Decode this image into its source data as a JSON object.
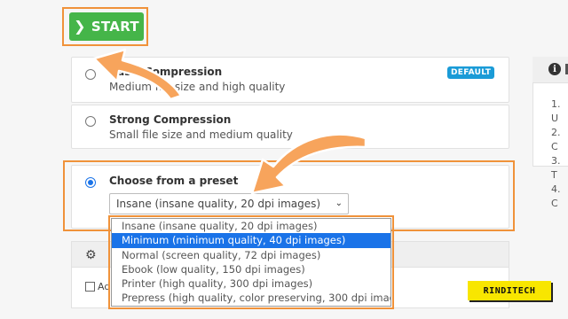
{
  "toolbar": {
    "start_label": "START",
    "start_icon": "chevron-right-icon"
  },
  "compression": {
    "options": [
      {
        "title": "Basic Compression",
        "subtitle": "Medium file size and high quality",
        "badge": "DEFAULT",
        "selected": false
      },
      {
        "title": "Strong Compression",
        "subtitle": "Small file size and medium quality",
        "selected": false
      },
      {
        "title": "Choose from a preset",
        "selected": true
      }
    ]
  },
  "preset": {
    "selected_value": "Insane (insane quality, 20 dpi images)",
    "items": [
      "Insane (insane quality, 20 dpi images)",
      "Minimum (minimum quality, 40 dpi images)",
      "Normal (screen quality, 72 dpi images)",
      "Ebook (low quality, 150 dpi images)",
      "Printer (high quality, 300 dpi images)",
      "Prepress (high quality, color preserving, 300 dpi images)"
    ],
    "highlighted_index": 1
  },
  "advanced": {
    "title": "",
    "checkbox_label": "Ad"
  },
  "info_panel": {
    "items": [
      "1. U",
      "2. C",
      "3. T",
      "4. C"
    ]
  },
  "watermark": "RINDITECH",
  "colors": {
    "accent": "#1a73e8",
    "start_green": "#45b549",
    "highlight_orange": "#f0923a",
    "badge_blue": "#1a9bd7",
    "brand_yellow": "#f8e600"
  }
}
